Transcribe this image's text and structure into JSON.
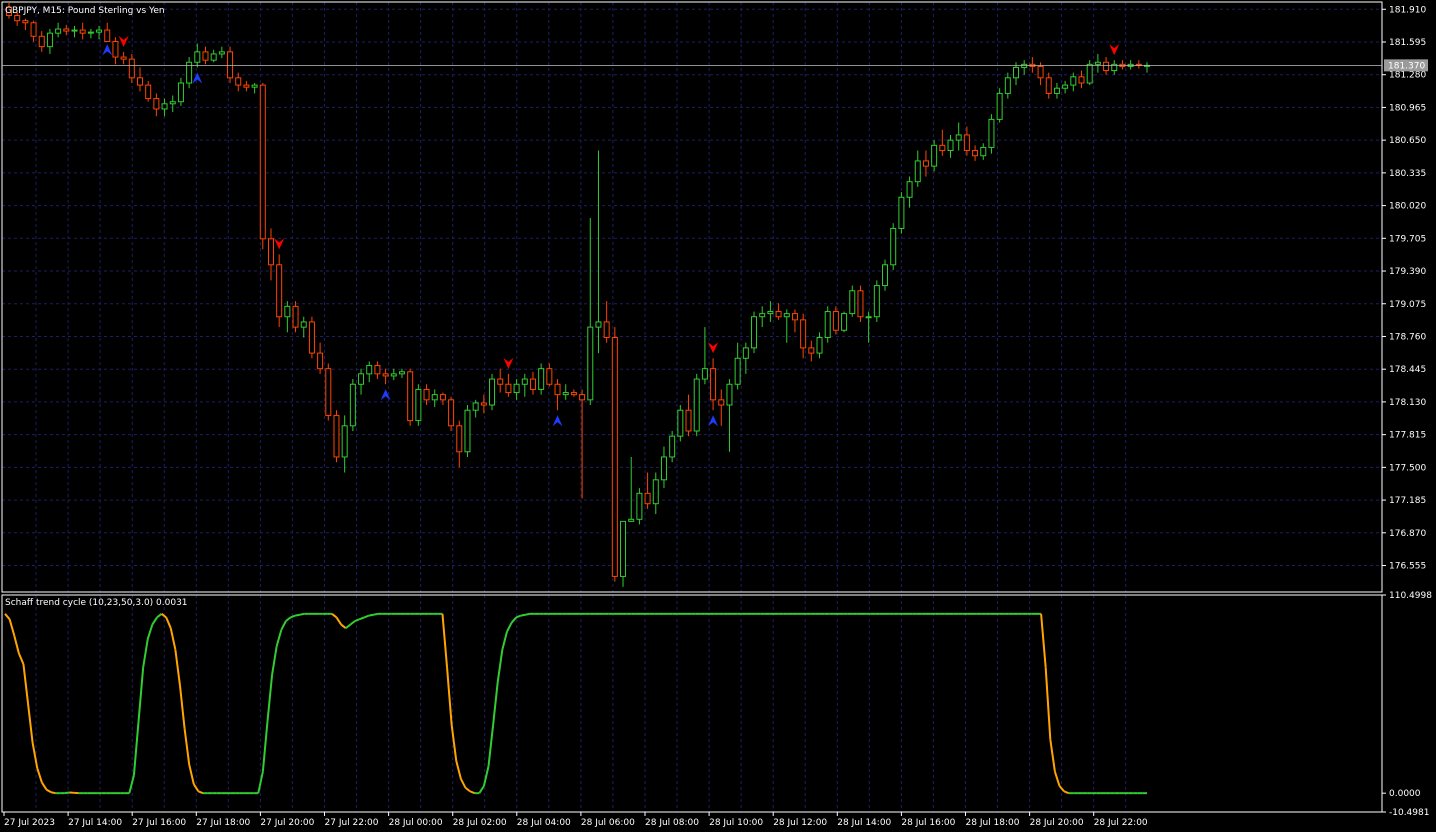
{
  "header": {
    "symbol_line": "GBPJPY, M15:  Pound Sterling vs Yen"
  },
  "indicator": {
    "label": "Schaff trend cycle (10,23,50,3.0) 0.0031"
  },
  "colors": {
    "background": "#000000",
    "grid": "#1e1e64",
    "frame": "#ffffff",
    "bull": "#32cd32",
    "bear": "#ff4500",
    "stc_up": "#32cd32",
    "stc_down": "#ffa500",
    "arrow_buy": "#1e3cff",
    "arrow_sell": "#ff0000",
    "price_line": "#c0c0c0"
  },
  "chart_data": [
    {
      "type": "candlestick",
      "symbol": "GBPJPY",
      "timeframe": "M15",
      "ylim": [
        176.3,
        181.98
      ],
      "y_ticks": [
        "181.910",
        "181.595",
        "181.280",
        "180.965",
        "180.650",
        "180.335",
        "180.020",
        "179.705",
        "179.390",
        "179.075",
        "178.760",
        "178.445",
        "178.130",
        "177.815",
        "177.500",
        "177.185",
        "176.870",
        "176.555"
      ],
      "x_ticks": [
        "27 Jul 2023",
        "27 Jul 14:00",
        "27 Jul 16:00",
        "27 Jul 18:00",
        "27 Jul 20:00",
        "27 Jul 22:00",
        "28 Jul 00:00",
        "28 Jul 02:00",
        "28 Jul 04:00",
        "28 Jul 06:00",
        "28 Jul 08:00",
        "28 Jul 10:00",
        "28 Jul 12:00",
        "28 Jul 14:00",
        "28 Jul 16:00",
        "28 Jul 18:00",
        "28 Jul 20:00",
        "28 Jul 22:00"
      ],
      "current_price": "181.370",
      "ohlc": [
        [
          181.93,
          181.97,
          181.82,
          181.85
        ],
        [
          181.85,
          181.88,
          181.75,
          181.8
        ],
        [
          181.8,
          181.82,
          181.71,
          181.78
        ],
        [
          181.78,
          181.8,
          181.6,
          181.65
        ],
        [
          181.65,
          181.7,
          181.5,
          181.55
        ],
        [
          181.55,
          181.72,
          181.48,
          181.68
        ],
        [
          181.68,
          181.78,
          181.64,
          181.72
        ],
        [
          181.72,
          181.76,
          181.66,
          181.7
        ],
        [
          181.7,
          181.75,
          181.64,
          181.71
        ],
        [
          181.71,
          181.78,
          181.62,
          181.68
        ],
        [
          181.68,
          181.72,
          181.63,
          181.69
        ],
        [
          181.69,
          181.75,
          181.62,
          181.71
        ],
        [
          181.71,
          181.78,
          181.62,
          181.6
        ],
        [
          181.6,
          181.64,
          181.38,
          181.45
        ],
        [
          181.45,
          181.5,
          181.38,
          181.43
        ],
        [
          181.43,
          181.48,
          181.2,
          181.25
        ],
        [
          181.25,
          181.35,
          181.12,
          181.18
        ],
        [
          181.18,
          181.22,
          181.02,
          181.05
        ],
        [
          181.05,
          181.1,
          180.88,
          180.95
        ],
        [
          180.95,
          181.05,
          180.88,
          181.0
        ],
        [
          181.0,
          181.08,
          180.92,
          181.02
        ],
        [
          181.02,
          181.25,
          180.98,
          181.2
        ],
        [
          181.2,
          181.45,
          181.15,
          181.4
        ],
        [
          181.4,
          181.58,
          181.35,
          181.5
        ],
        [
          181.5,
          181.55,
          181.38,
          181.42
        ],
        [
          181.42,
          181.52,
          181.4,
          181.48
        ],
        [
          181.48,
          181.55,
          181.44,
          181.5
        ],
        [
          181.5,
          181.55,
          181.2,
          181.25
        ],
        [
          181.25,
          181.3,
          181.12,
          181.18
        ],
        [
          181.18,
          181.22,
          181.12,
          181.16
        ],
        [
          181.16,
          181.2,
          181.1,
          181.18
        ],
        [
          181.18,
          181.2,
          179.6,
          179.7
        ],
        [
          179.7,
          179.8,
          179.3,
          179.45
        ],
        [
          179.45,
          179.55,
          178.85,
          178.95
        ],
        [
          178.95,
          179.1,
          178.8,
          179.05
        ],
        [
          179.05,
          179.1,
          178.8,
          178.85
        ],
        [
          178.85,
          178.95,
          178.75,
          178.9
        ],
        [
          178.9,
          178.95,
          178.55,
          178.6
        ],
        [
          178.6,
          178.7,
          178.4,
          178.45
        ],
        [
          178.45,
          178.5,
          177.95,
          178.0
        ],
        [
          178.0,
          178.05,
          177.55,
          177.6
        ],
        [
          177.6,
          178.0,
          177.45,
          177.9
        ],
        [
          177.9,
          178.35,
          177.85,
          178.3
        ],
        [
          178.3,
          178.45,
          178.2,
          178.4
        ],
        [
          178.4,
          178.52,
          178.32,
          178.48
        ],
        [
          178.48,
          178.52,
          178.35,
          178.4
        ],
        [
          178.4,
          178.45,
          178.3,
          178.38
        ],
        [
          178.38,
          178.45,
          178.34,
          178.4
        ],
        [
          178.4,
          178.45,
          178.36,
          178.42
        ],
        [
          178.42,
          178.45,
          177.9,
          177.95
        ],
        [
          177.95,
          178.3,
          177.9,
          178.25
        ],
        [
          178.25,
          178.3,
          178.1,
          178.15
        ],
        [
          178.15,
          178.25,
          178.08,
          178.2
        ],
        [
          178.2,
          178.22,
          178.1,
          178.15
        ],
        [
          178.15,
          178.18,
          177.85,
          177.9
        ],
        [
          177.9,
          177.95,
          177.5,
          177.65
        ],
        [
          177.65,
          178.1,
          177.6,
          178.05
        ],
        [
          178.05,
          178.15,
          177.98,
          178.12
        ],
        [
          178.12,
          178.2,
          178.02,
          178.1
        ],
        [
          178.1,
          178.4,
          178.05,
          178.35
        ],
        [
          178.35,
          178.45,
          178.22,
          178.3
        ],
        [
          178.3,
          178.4,
          178.18,
          178.22
        ],
        [
          178.22,
          178.35,
          178.15,
          178.3
        ],
        [
          178.3,
          178.4,
          178.18,
          178.35
        ],
        [
          178.35,
          178.42,
          178.2,
          178.25
        ],
        [
          178.25,
          178.5,
          178.2,
          178.45
        ],
        [
          178.45,
          178.5,
          178.28,
          178.3
        ],
        [
          178.3,
          178.35,
          178.05,
          178.2
        ],
        [
          178.2,
          178.3,
          178.15,
          178.22
        ],
        [
          178.22,
          178.25,
          178.18,
          178.2
        ],
        [
          178.2,
          178.25,
          177.2,
          178.15
        ],
        [
          178.15,
          179.9,
          178.1,
          178.85
        ],
        [
          178.85,
          180.55,
          178.6,
          178.9
        ],
        [
          178.9,
          179.1,
          178.7,
          178.75
        ],
        [
          178.75,
          178.85,
          176.4,
          176.45
        ],
        [
          176.45,
          176.75,
          176.35,
          176.98
        ],
        [
          176.98,
          177.6,
          176.98,
          177.0
        ],
        [
          177.0,
          177.3,
          176.95,
          177.25
        ],
        [
          177.25,
          177.45,
          177.1,
          177.15
        ],
        [
          177.15,
          177.45,
          177.05,
          177.38
        ],
        [
          177.38,
          177.7,
          177.3,
          177.6
        ],
        [
          177.6,
          177.85,
          177.55,
          177.8
        ],
        [
          177.8,
          178.1,
          177.75,
          178.05
        ],
        [
          178.05,
          178.2,
          177.8,
          177.85
        ],
        [
          177.85,
          178.4,
          177.8,
          178.35
        ],
        [
          178.35,
          178.85,
          178.3,
          178.45
        ],
        [
          178.45,
          178.55,
          178.05,
          178.15
        ],
        [
          178.15,
          178.25,
          177.9,
          178.1
        ],
        [
          178.1,
          178.35,
          177.65,
          178.3
        ],
        [
          178.3,
          178.7,
          178.25,
          178.55
        ],
        [
          178.55,
          178.7,
          178.4,
          178.65
        ],
        [
          178.65,
          179.0,
          178.6,
          178.95
        ],
        [
          178.95,
          179.05,
          178.85,
          178.98
        ],
        [
          178.98,
          179.1,
          178.9,
          179.0
        ],
        [
          179.0,
          179.08,
          178.92,
          178.95
        ],
        [
          178.95,
          179.02,
          178.7,
          178.98
        ],
        [
          178.98,
          179.02,
          178.8,
          178.92
        ],
        [
          178.92,
          178.98,
          178.55,
          178.65
        ],
        [
          178.65,
          178.72,
          178.52,
          178.6
        ],
        [
          178.6,
          178.8,
          178.55,
          178.75
        ],
        [
          178.75,
          179.05,
          178.7,
          179.0
        ],
        [
          179.0,
          179.05,
          178.78,
          178.82
        ],
        [
          178.82,
          179.0,
          178.8,
          178.98
        ],
        [
          178.98,
          179.25,
          178.95,
          179.2
        ],
        [
          179.2,
          179.25,
          178.9,
          178.95
        ],
        [
          178.95,
          179.0,
          178.7,
          178.95
        ],
        [
          178.95,
          179.3,
          178.9,
          179.25
        ],
        [
          179.25,
          179.5,
          179.2,
          179.45
        ],
        [
          179.45,
          179.85,
          179.4,
          179.8
        ],
        [
          179.8,
          180.15,
          179.75,
          180.1
        ],
        [
          180.1,
          180.3,
          180.0,
          180.25
        ],
        [
          180.25,
          180.55,
          180.2,
          180.45
        ],
        [
          180.45,
          180.55,
          180.3,
          180.4
        ],
        [
          180.4,
          180.65,
          180.35,
          180.6
        ],
        [
          180.6,
          180.75,
          180.5,
          180.55
        ],
        [
          180.55,
          180.7,
          180.48,
          180.65
        ],
        [
          180.65,
          180.82,
          180.55,
          180.7
        ],
        [
          180.7,
          180.78,
          180.5,
          180.55
        ],
        [
          180.55,
          180.6,
          180.45,
          180.5
        ],
        [
          180.5,
          180.62,
          180.46,
          180.58
        ],
        [
          180.58,
          180.9,
          180.52,
          180.85
        ],
        [
          180.85,
          181.15,
          180.82,
          181.1
        ],
        [
          181.1,
          181.3,
          181.05,
          181.25
        ],
        [
          181.25,
          181.4,
          181.18,
          181.35
        ],
        [
          181.35,
          181.42,
          181.28,
          181.38
        ],
        [
          181.38,
          181.45,
          181.3,
          181.36
        ],
        [
          181.36,
          181.4,
          181.18,
          181.25
        ],
        [
          181.25,
          181.3,
          181.05,
          181.1
        ],
        [
          181.1,
          181.2,
          181.05,
          181.15
        ],
        [
          181.15,
          181.22,
          181.1,
          181.18
        ],
        [
          181.18,
          181.3,
          181.12,
          181.26
        ],
        [
          181.26,
          181.32,
          181.15,
          181.2
        ],
        [
          181.2,
          181.42,
          181.18,
          181.38
        ],
        [
          181.38,
          181.48,
          181.3,
          181.4
        ],
        [
          181.4,
          181.45,
          181.28,
          181.32
        ],
        [
          181.32,
          181.42,
          181.28,
          181.38
        ],
        [
          181.38,
          181.42,
          181.33,
          181.36
        ],
        [
          181.36,
          181.42,
          181.33,
          181.38
        ],
        [
          181.38,
          181.42,
          181.34,
          181.37
        ],
        [
          181.37,
          181.4,
          181.3,
          181.37
        ]
      ],
      "buy_signals": [
        12,
        23,
        46,
        67,
        86
      ],
      "sell_signals": [
        14,
        33,
        61,
        86,
        135
      ]
    },
    {
      "type": "line",
      "name": "Schaff trend cycle (10,23,50,3.0)",
      "ylim": [
        -10.4981,
        110.4998
      ],
      "y_ticks": [
        "110.4998",
        "0.0000",
        "-10.4981"
      ],
      "values": [
        100,
        97,
        88,
        78,
        72,
        50,
        28,
        14,
        6,
        2,
        0.5,
        0,
        0,
        0,
        0.4,
        0.2,
        0,
        0,
        0,
        0,
        0,
        0,
        0,
        0,
        0,
        0,
        0,
        0,
        10,
        40,
        70,
        86,
        94,
        98,
        100,
        98,
        92,
        80,
        60,
        36,
        16,
        5,
        1,
        0,
        0,
        0,
        0,
        0,
        0,
        0,
        0,
        0,
        0,
        0,
        0,
        0,
        12,
        40,
        66,
        82,
        91,
        96,
        98,
        99,
        99.5,
        100,
        100,
        100,
        100,
        100,
        100,
        100,
        98,
        94,
        92,
        94,
        96,
        97,
        98,
        99,
        99.5,
        100,
        100,
        100,
        100,
        100,
        100,
        100,
        100,
        100,
        100,
        100,
        100,
        100,
        100,
        100,
        70,
        38,
        18,
        8,
        3,
        1,
        0,
        0,
        4,
        15,
        38,
        62,
        80,
        90,
        95,
        98,
        99,
        99.5,
        100,
        100,
        100,
        100,
        100,
        100,
        100,
        100,
        100,
        100,
        100,
        100,
        100,
        100,
        100,
        100,
        100,
        100,
        100,
        100,
        100,
        100,
        100,
        100,
        100,
        100,
        100,
        100,
        100,
        100,
        100,
        100,
        100,
        100,
        100,
        100,
        100,
        100,
        100,
        100,
        100,
        100,
        100,
        100,
        100,
        100,
        100,
        100,
        100,
        100,
        100,
        100,
        100,
        100,
        100,
        100,
        100,
        100,
        100,
        100,
        100,
        100,
        100,
        100,
        100,
        100,
        100,
        100,
        100,
        100,
        100,
        100,
        100,
        100,
        100,
        100,
        100,
        100,
        100,
        100,
        100,
        100,
        100,
        100,
        100,
        100,
        100,
        100,
        100,
        100,
        100,
        100,
        100,
        100,
        100,
        100,
        100,
        100,
        100,
        100,
        100,
        100,
        100,
        100,
        100,
        100,
        100,
        100,
        100,
        100,
        100,
        100,
        70,
        30,
        12,
        4,
        1,
        0,
        0,
        0,
        0,
        0,
        0,
        0,
        0,
        0,
        0,
        0,
        0,
        0,
        0,
        0,
        0,
        0,
        0
      ]
    }
  ]
}
